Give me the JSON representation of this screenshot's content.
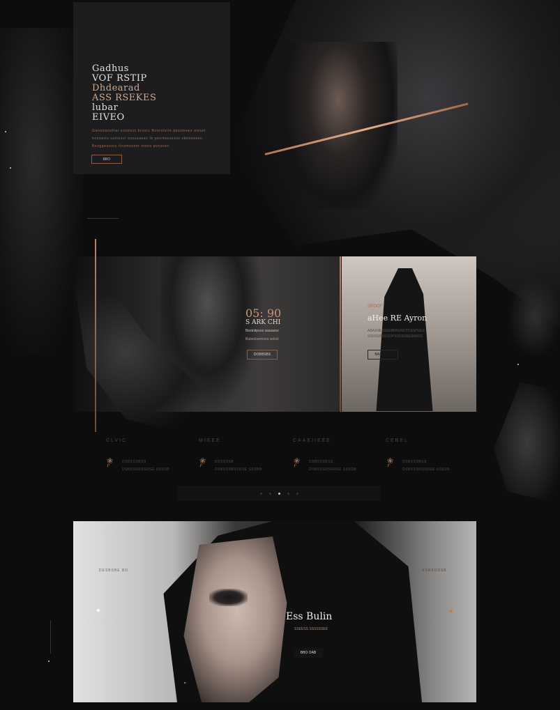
{
  "hero": {
    "title_lines": [
      "Gadhus",
      "VOF RSTIP",
      "Dhdearad",
      "ASS RSEKES",
      "lubar",
      "EIVEO"
    ],
    "body_lines": [
      "Ganonwoofrar sosmest bruorc Bonrutstin dansmeeo alsset",
      "hoooorio sslnoscr ossssaeec Ib pesrtoessoso sbesoeeeo",
      "Besggeaosrs rlosmsooer sroos pvosseo"
    ],
    "button_label": "BBO"
  },
  "gallery": {
    "panel_a": {
      "title": "05: 90",
      "subtitle": "S ARK CHI",
      "line1": "Bestnitpoos sasaarso",
      "line2": "Bubestsernoes selsol",
      "button_label": "DOBBSBS"
    },
    "panel_b": {
      "kicker": "SROOF",
      "title": "aHee RE Ayron",
      "line1": "ABASNESSEEBERUSOTOSSPUES",
      "line2": "SSOSSBUSSOPSSOSSBESREDS",
      "button_label": "BASSBBE"
    }
  },
  "features": [
    {
      "heading": "CLVIC",
      "line1": "DSBSSSBSS",
      "line2": "DSBSSSRSSRSE SSSSB"
    },
    {
      "heading": "MIEEE",
      "line1": "DSSSSSB",
      "line2": "DSBSSSBSSRSE SSSBB"
    },
    {
      "heading": "CAAEIIEEE",
      "line1": "DSBSSSBSS",
      "line2": "DSBSSSRSSRSE SSSSB"
    },
    {
      "heading": "CEBEL",
      "line1": "DSBSSSBSS",
      "line2": "DSBSSSRSSRSE SSSSB"
    }
  ],
  "feature_icon": "ornament-icon",
  "pager": {
    "total": 5,
    "active": 3
  },
  "bottom": {
    "left_label": "DESBSBE BD",
    "right_label": "SSRSOSSB",
    "title": "Ess Bulin",
    "line": "SSEESS SSSSSSEE",
    "button_label": "BBO OAB",
    "quote": "“"
  },
  "colors": {
    "accent_copper": "#c08a6a",
    "background": "#0d0d0e",
    "card": "#1d1d1f"
  }
}
